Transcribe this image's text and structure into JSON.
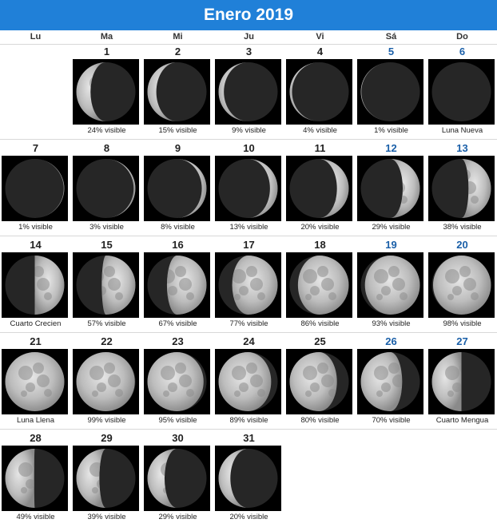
{
  "title": "Enero 2019",
  "colors": {
    "header": "#2080d8",
    "weekend_number": "#1a5fa8"
  },
  "weekdays": [
    "Lu",
    "Ma",
    "Mi",
    "Ju",
    "Vi",
    "Sá",
    "Do"
  ],
  "days": [
    {
      "day": "1",
      "caption": "24% visible",
      "illum": 0.24,
      "waxing": false
    },
    {
      "day": "2",
      "caption": "15% visible",
      "illum": 0.15,
      "waxing": false
    },
    {
      "day": "3",
      "caption": "9% visible",
      "illum": 0.09,
      "waxing": false
    },
    {
      "day": "4",
      "caption": "4% visible",
      "illum": 0.04,
      "waxing": false
    },
    {
      "day": "5",
      "caption": "1% visible",
      "illum": 0.01,
      "waxing": false
    },
    {
      "day": "6",
      "caption": "Luna Nueva",
      "illum": 0.0,
      "waxing": false
    },
    {
      "day": "7",
      "caption": "1% visible",
      "illum": 0.01,
      "waxing": true
    },
    {
      "day": "8",
      "caption": "3% visible",
      "illum": 0.03,
      "waxing": true
    },
    {
      "day": "9",
      "caption": "8% visible",
      "illum": 0.08,
      "waxing": true
    },
    {
      "day": "10",
      "caption": "13% visible",
      "illum": 0.13,
      "waxing": true
    },
    {
      "day": "11",
      "caption": "20% visible",
      "illum": 0.2,
      "waxing": true
    },
    {
      "day": "12",
      "caption": "29% visible",
      "illum": 0.29,
      "waxing": true
    },
    {
      "day": "13",
      "caption": "38% visible",
      "illum": 0.38,
      "waxing": true
    },
    {
      "day": "14",
      "caption": "Cuarto Crecien",
      "illum": 0.5,
      "waxing": true
    },
    {
      "day": "15",
      "caption": "57% visible",
      "illum": 0.57,
      "waxing": true
    },
    {
      "day": "16",
      "caption": "67% visible",
      "illum": 0.67,
      "waxing": true
    },
    {
      "day": "17",
      "caption": "77% visible",
      "illum": 0.77,
      "waxing": true
    },
    {
      "day": "18",
      "caption": "86% visible",
      "illum": 0.86,
      "waxing": true
    },
    {
      "day": "19",
      "caption": "93% visible",
      "illum": 0.93,
      "waxing": true
    },
    {
      "day": "20",
      "caption": "98% visible",
      "illum": 0.98,
      "waxing": true
    },
    {
      "day": "21",
      "caption": "Luna Llena",
      "illum": 1.0,
      "waxing": false
    },
    {
      "day": "22",
      "caption": "99% visible",
      "illum": 0.99,
      "waxing": false
    },
    {
      "day": "23",
      "caption": "95% visible",
      "illum": 0.95,
      "waxing": false
    },
    {
      "day": "24",
      "caption": "89% visible",
      "illum": 0.89,
      "waxing": false
    },
    {
      "day": "25",
      "caption": "80% visible",
      "illum": 0.8,
      "waxing": false
    },
    {
      "day": "26",
      "caption": "70% visible",
      "illum": 0.7,
      "waxing": false
    },
    {
      "day": "27",
      "caption": "Cuarto Mengua",
      "illum": 0.5,
      "waxing": false
    },
    {
      "day": "28",
      "caption": "49% visible",
      "illum": 0.49,
      "waxing": false
    },
    {
      "day": "29",
      "caption": "39% visible",
      "illum": 0.39,
      "waxing": false
    },
    {
      "day": "30",
      "caption": "29% visible",
      "illum": 0.29,
      "waxing": false
    },
    {
      "day": "31",
      "caption": "20% visible",
      "illum": 0.2,
      "waxing": false
    }
  ]
}
